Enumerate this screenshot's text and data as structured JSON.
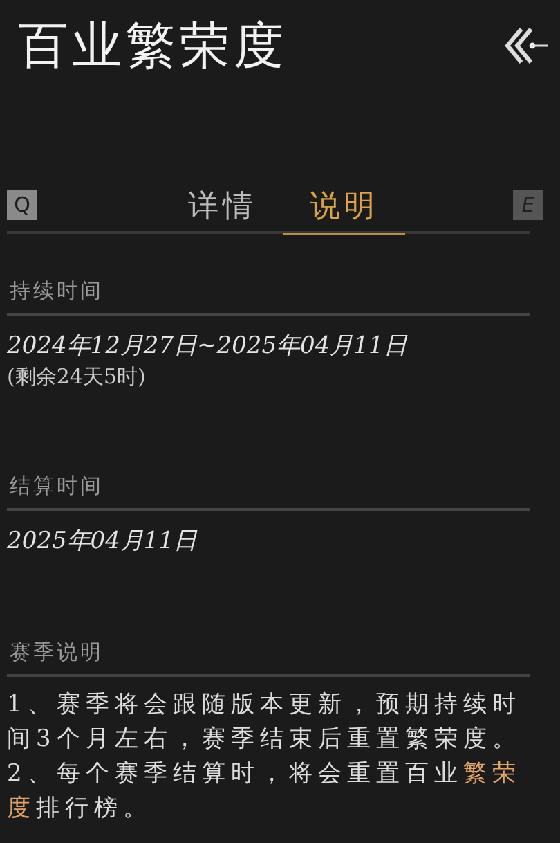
{
  "title": "百业繁荣度",
  "tabs": [
    {
      "key": "Q",
      "kind": "key"
    },
    {
      "label": "详情",
      "selected": false,
      "kind": "tab"
    },
    {
      "label": "说明",
      "selected": true,
      "kind": "tab"
    },
    {
      "key": "E",
      "kind": "key"
    }
  ],
  "sections": [
    {
      "heading": "持续时间",
      "kind": "date",
      "lines": [
        "2024年12月27日~2025年04月11日",
        "(剩余24天5时)"
      ]
    },
    {
      "heading": "结算时间",
      "kind": "date",
      "lines": [
        "2025年04月11日"
      ]
    },
    {
      "heading": "赛季说明",
      "kind": "notes",
      "notes": [
        [
          {
            "text": "1、赛季将会跟随版本更新，预期持续时间3个月左右，赛季结束后重置繁荣度。",
            "highlight": false
          }
        ],
        [
          {
            "text": "2、每个赛季结算时，将会重置百业",
            "highlight": false
          },
          {
            "text": "繁荣度",
            "highlight": true
          },
          {
            "text": "排行榜。",
            "highlight": false
          }
        ]
      ]
    }
  ]
}
